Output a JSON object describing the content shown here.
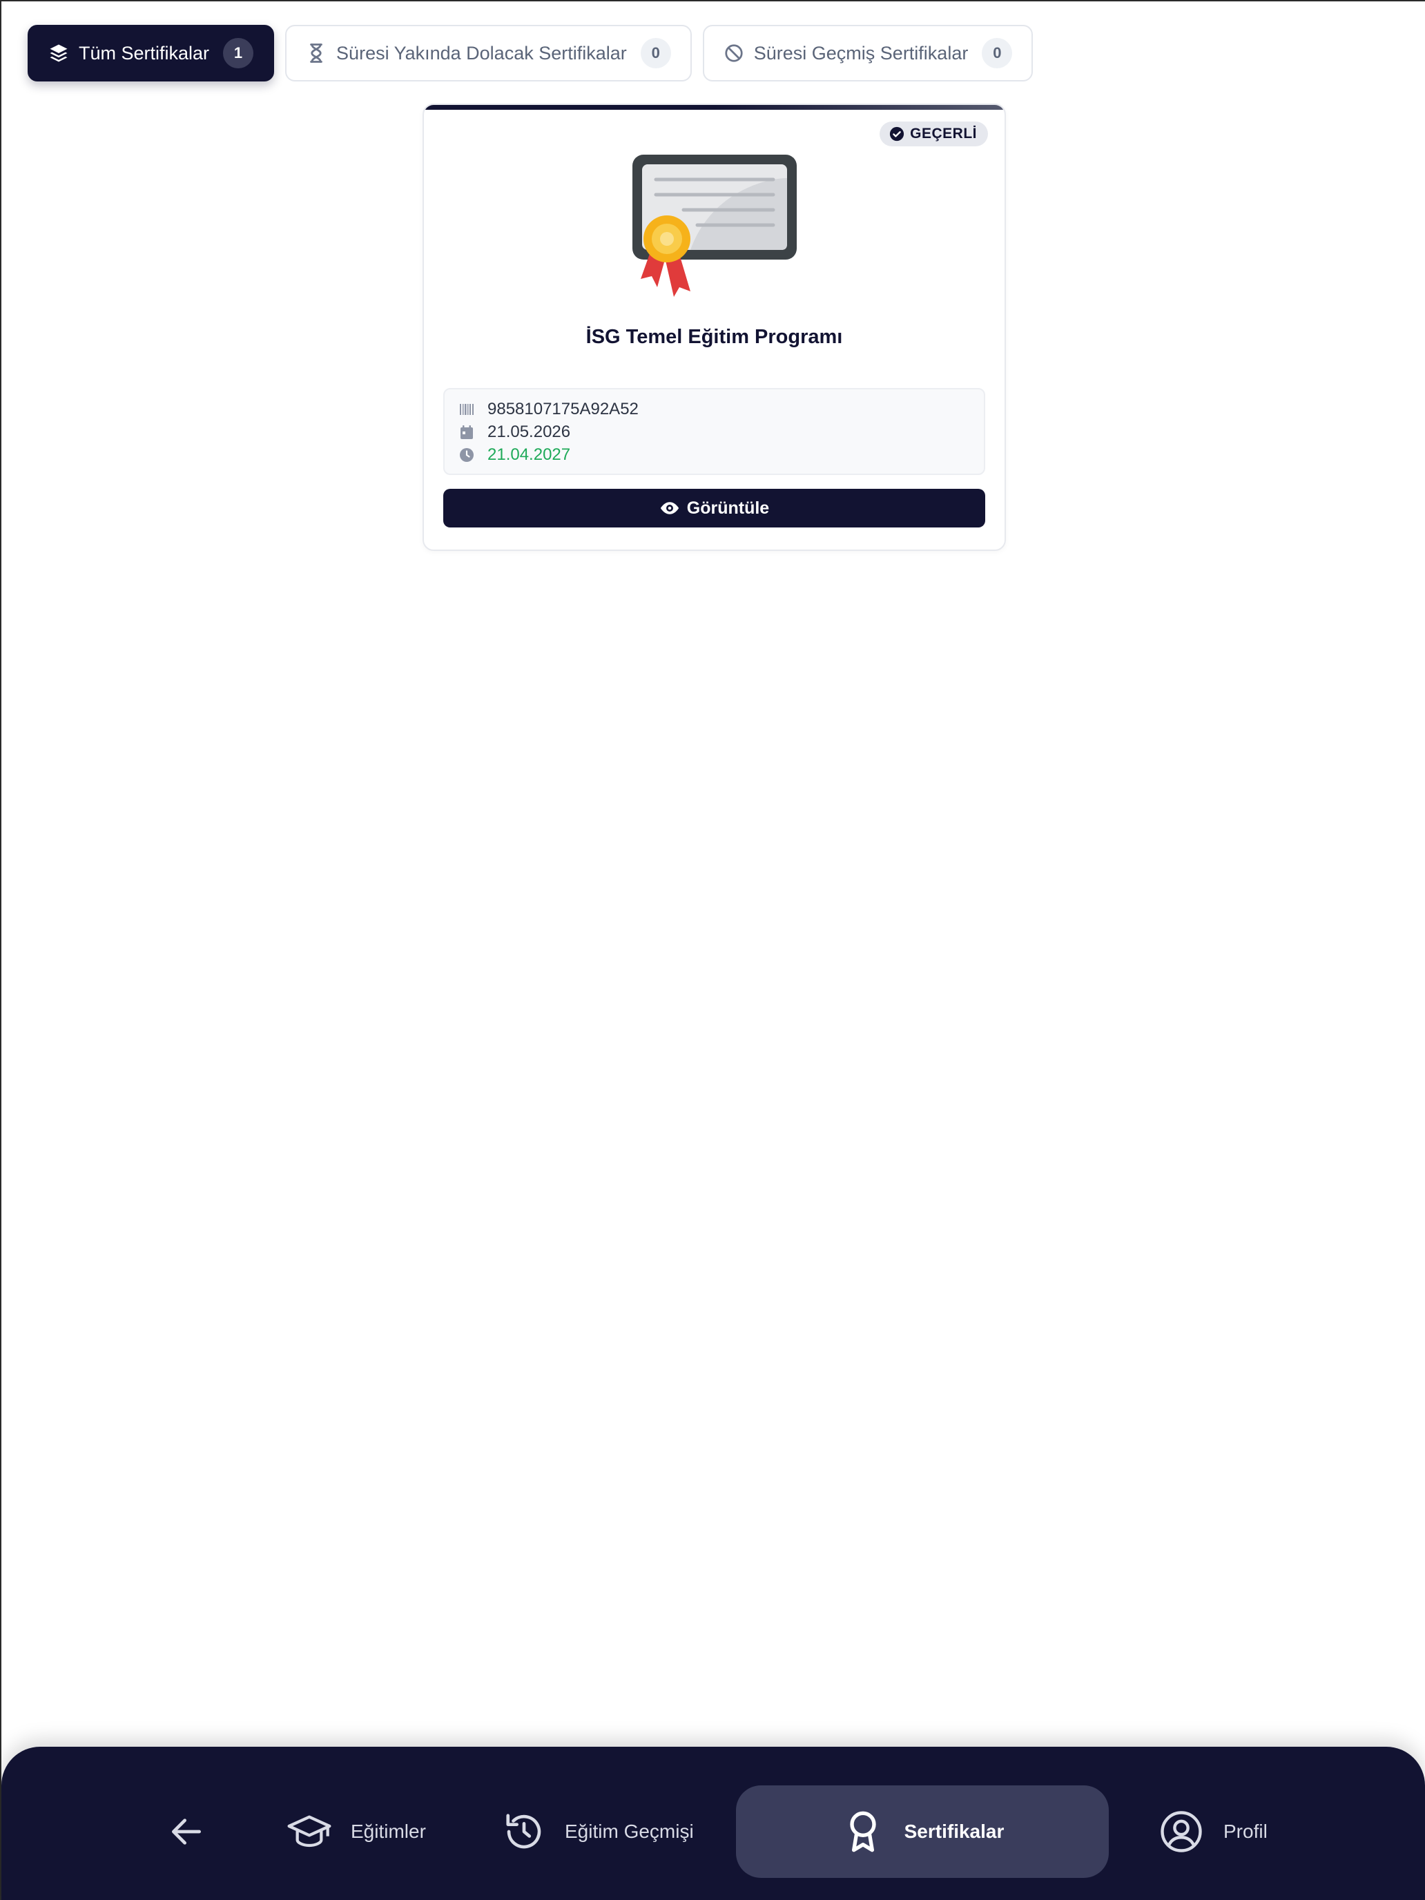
{
  "tabs": [
    {
      "label": "Tüm Sertifikalar",
      "count": "1",
      "icon": "layers-icon",
      "active": true
    },
    {
      "label": "Süresi Yakında Dolacak Sertifikalar",
      "count": "0",
      "icon": "hourglass-icon",
      "active": false
    },
    {
      "label": "Süresi Geçmiş Sertifikalar",
      "count": "0",
      "icon": "ban-icon",
      "active": false
    }
  ],
  "certificate": {
    "status": "GEÇERLİ",
    "title": "İSG Temel Eğitim Programı",
    "code": "9858107175A92A52",
    "issue_date": "21.05.2026",
    "expiry_date": "21.04.2027",
    "view_label": "Görüntüle"
  },
  "bottom_nav": {
    "back_icon": "arrow-left-icon",
    "items": [
      {
        "label": "Eğitimler",
        "icon": "graduation-cap-icon"
      },
      {
        "label": "Eğitim Geçmişi",
        "icon": "history-icon"
      },
      {
        "label": "Sertifikalar",
        "icon": "award-icon",
        "active": true
      },
      {
        "label": "Profil",
        "icon": "user-circle-icon"
      }
    ]
  },
  "colors": {
    "primary": "#121332",
    "expiry_green": "#1faa59",
    "nav_active": "#3a3d5c"
  }
}
